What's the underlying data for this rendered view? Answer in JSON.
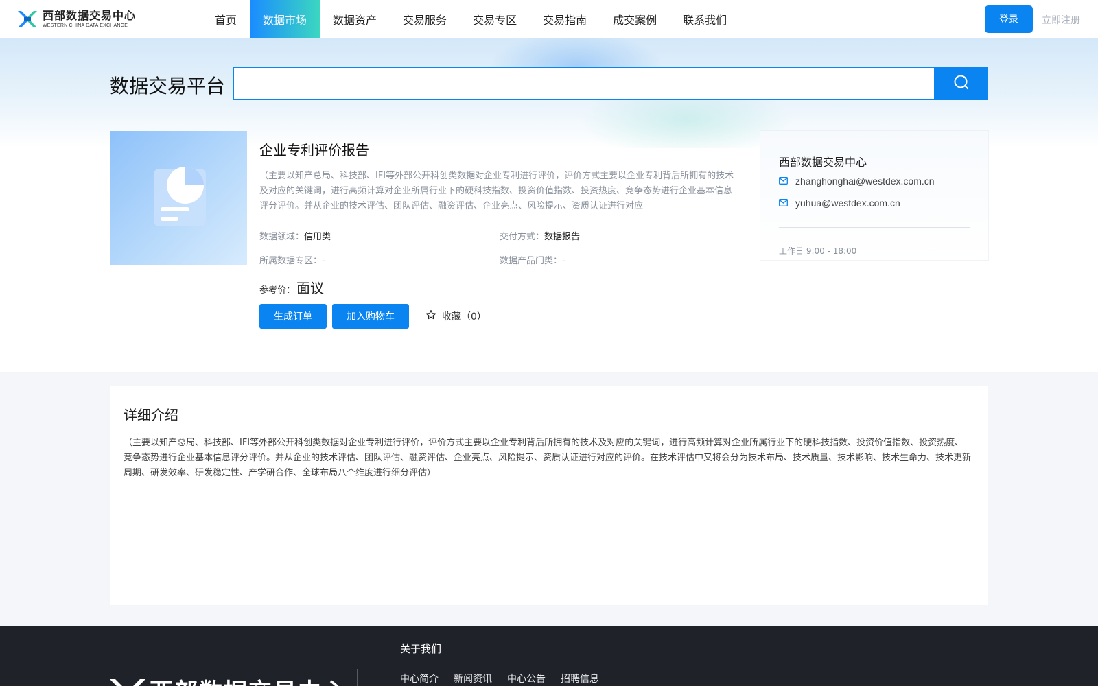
{
  "header": {
    "logo_cn": "西部数据交易中心",
    "logo_en": "WESTERN CHINA DATA EXCHANGE",
    "nav": [
      {
        "label": "首页",
        "active": false
      },
      {
        "label": "数据市场",
        "active": true
      },
      {
        "label": "数据资产",
        "active": false
      },
      {
        "label": "交易服务",
        "active": false
      },
      {
        "label": "交易专区",
        "active": false
      },
      {
        "label": "交易指南",
        "active": false
      },
      {
        "label": "成交案例",
        "active": false
      },
      {
        "label": "联系我们",
        "active": false
      }
    ],
    "login_label": "登录",
    "register_label": "立即注册"
  },
  "search": {
    "platform_title": "数据交易平台",
    "value": "",
    "button_icon": "search-icon"
  },
  "product": {
    "title": "企业专利评价报告",
    "description": "（主要以知产总局、科技部、IFI等外部公开科创类数据对企业专利进行评价，评价方式主要以企业专利背后所拥有的技术及对应的关键词，进行高频计算对企业所属行业下的硬科技指数、投资价值指数、投资热度、竞争态势进行企业基本信息评分评价。并从企业的技术评估、团队评估、融资评估、企业亮点、风险提示、资质认证进行对应",
    "meta": {
      "domain_label": "数据领域：",
      "domain_value": "信用类",
      "delivery_label": "交付方式：",
      "delivery_value": "数据报告",
      "zone_label": "所属数据专区：",
      "zone_value": "-",
      "category_label": "数据产品门类：",
      "category_value": "-"
    },
    "price_label": "参考价：",
    "price_value": "面议",
    "order_button": "生成订单",
    "cart_button": "加入购物车",
    "favorite_label": "收藏（0）"
  },
  "contact": {
    "name": "西部数据交易中心",
    "emails": [
      "zhanghonghai@westdex.com.cn",
      "yuhua@westdex.com.cn"
    ],
    "hours": "工作日 9:00 - 18:00"
  },
  "detail": {
    "title": "详细介绍",
    "body": "（主要以知产总局、科技部、IFI等外部公开科创类数据对企业专利进行评价，评价方式主要以企业专利背后所拥有的技术及对应的关键词，进行高频计算对企业所属行业下的硬科技指数、投资价值指数、投资热度、竞争态势进行企业基本信息评分评价。并从企业的技术评估、团队评估、融资评估、企业亮点、风险提示、资质认证进行对应的评价。在技术评估中又将会分为技术布局、技术质量、技术影响、技术生命力、技术更新周期、研发效率、研发稳定性、产学研合作、全球布局八个维度进行细分评估）"
  },
  "footer": {
    "logo_text": "西部数据交易中心",
    "about_title": "关于我们",
    "links": [
      "中心简介",
      "新闻资讯",
      "中心公告",
      "招聘信息"
    ]
  },
  "colors": {
    "primary": "#0a84f0",
    "nav_gradient_start": "#1a8cff",
    "nav_gradient_end": "#3bd7c0",
    "footer_bg": "#1f2229"
  }
}
